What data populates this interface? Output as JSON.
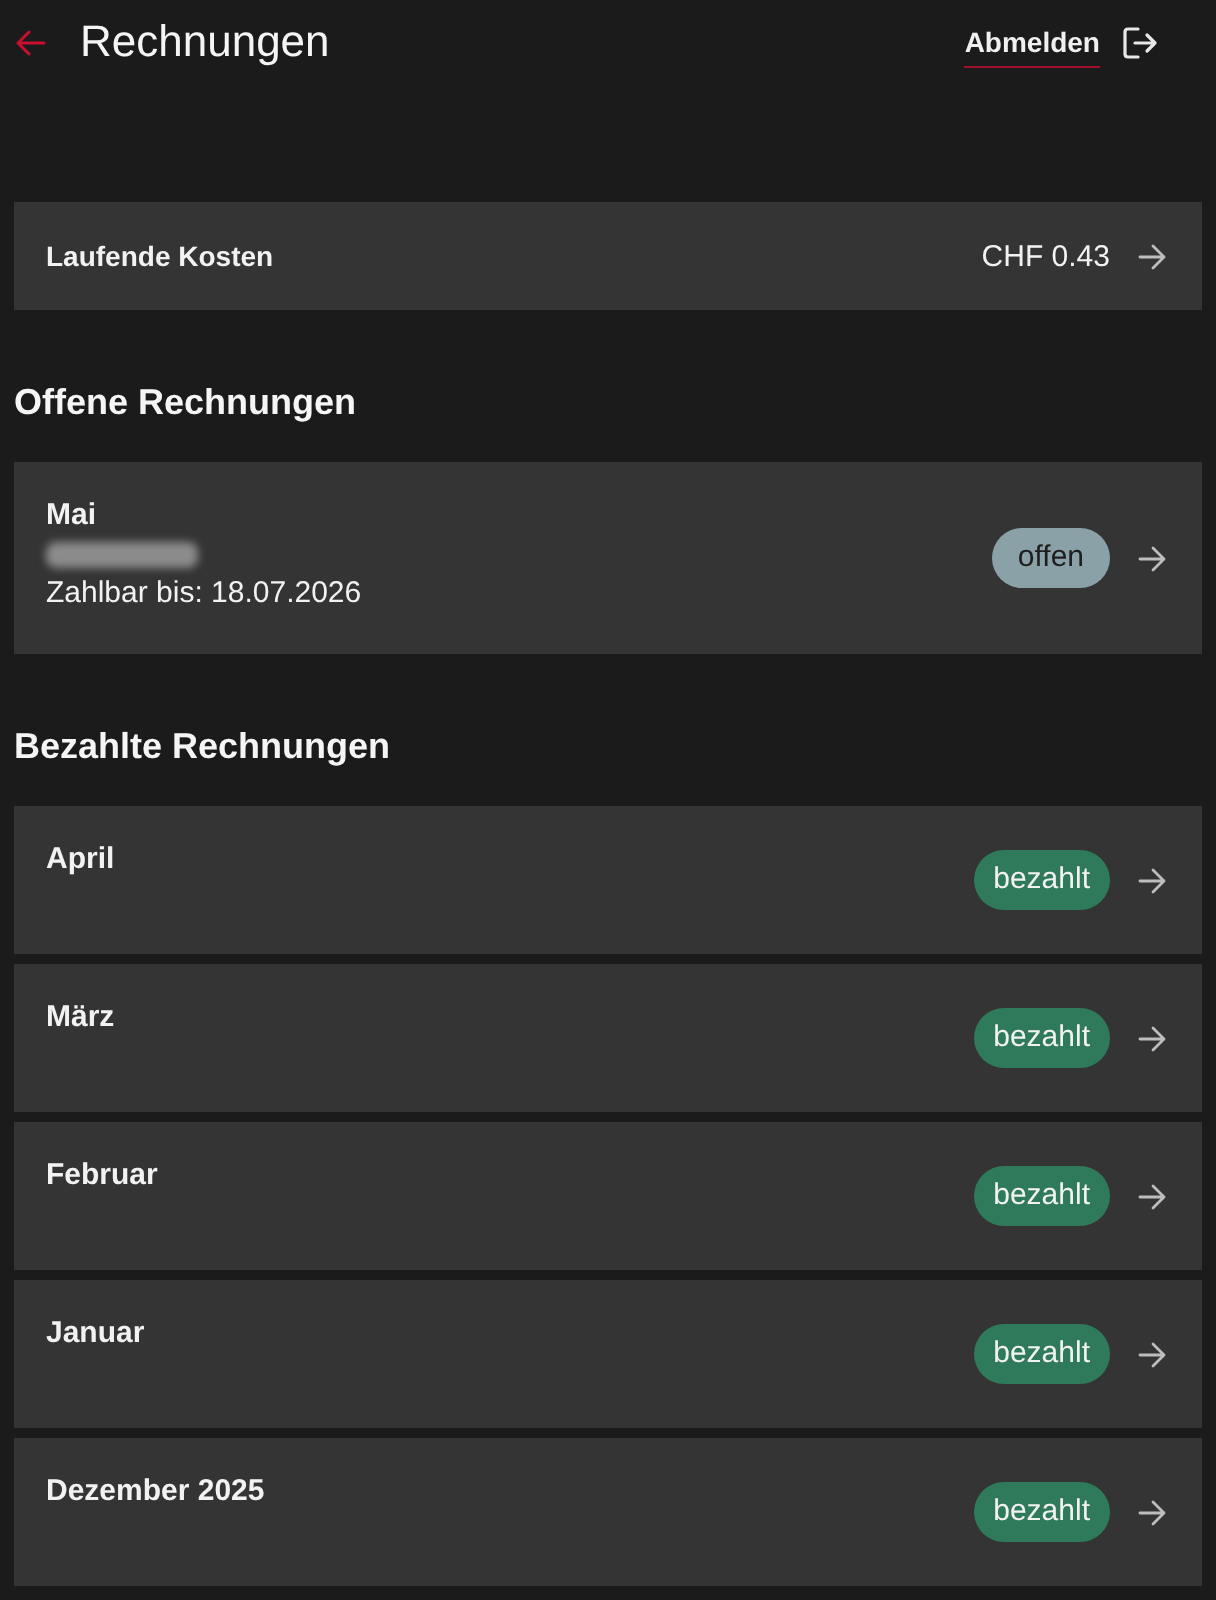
{
  "header": {
    "title": "Rechnungen",
    "logout_label": "Abmelden"
  },
  "running_costs": {
    "label": "Laufende Kosten",
    "amount": "CHF 0.43"
  },
  "sections": [
    {
      "title": "Offene Rechnungen",
      "invoices": [
        {
          "month": "Mai",
          "amount_hidden": true,
          "due": "Zahlbar bis: 18.07.2026",
          "kind": "open",
          "badge": "offen"
        }
      ]
    },
    {
      "title": "Bezahlte Rechnungen",
      "invoices": [
        {
          "month": "April",
          "kind": "paid",
          "badge": "bezahlt"
        },
        {
          "month": "März",
          "kind": "paid",
          "badge": "bezahlt"
        },
        {
          "month": "Februar",
          "kind": "paid",
          "badge": "bezahlt"
        },
        {
          "month": "Januar",
          "kind": "paid",
          "badge": "bezahlt"
        },
        {
          "month": "Dezember 2025",
          "kind": "paid",
          "badge": "bezahlt"
        }
      ]
    }
  ]
}
